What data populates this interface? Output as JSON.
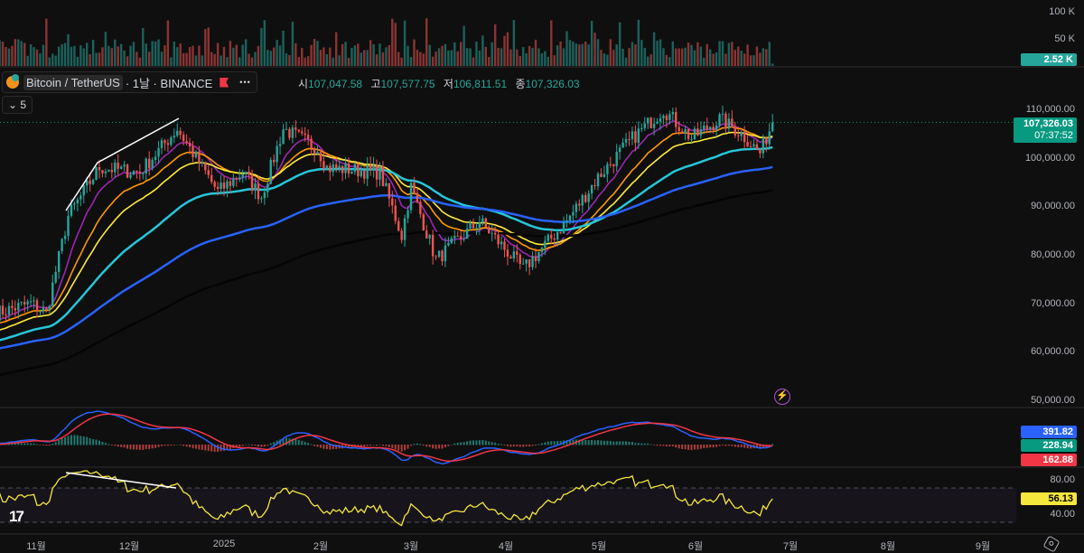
{
  "legend": {
    "symbol": "Bitcoin / TetherUS",
    "interval": "· 1날 · BINANCE",
    "more": "•••",
    "ohlc": [
      {
        "k": "시",
        "v": "107,047.58"
      },
      {
        "k": "고",
        "v": "107,577.75"
      },
      {
        "k": "저",
        "v": "106,811.51"
      },
      {
        "k": "종",
        "v": "107,326.03"
      }
    ],
    "collapse": "5"
  },
  "price_axis": [
    "110,000.00",
    "100,000.00",
    "90,000.00",
    "80,000.00",
    "70,000.00",
    "60,000.00",
    "50,000.00"
  ],
  "volume_axis": [
    "100 K",
    "50 K"
  ],
  "volume_tag": "2.52 K",
  "last_price": {
    "price": "107,326.03",
    "countdown": "07:37:52"
  },
  "macd_tags": {
    "macd": "391.82",
    "histogram": "228.94",
    "signal": "162.88"
  },
  "rsi_axis": [
    "80.00",
    "40.00"
  ],
  "rsi_tag": "56.13",
  "time_axis": [
    "11월",
    "12월",
    "2025",
    "2월",
    "3월",
    "4월",
    "5월",
    "6월",
    "7월",
    "8월",
    "9월"
  ],
  "colors": {
    "up": "#26a69a",
    "down": "#ef5350",
    "accent": "#089981",
    "macd": "#2962ff",
    "signal": "#f23645",
    "rsi": "#f5e83c"
  },
  "icons": {
    "logo": "tradingview-logo",
    "alert": "lightning-icon",
    "settings": "gear-icon",
    "flag": "flag-icon"
  },
  "chart_data": {
    "type": "candlestick",
    "symbol": "BTCUSDT",
    "timeframe": "1D",
    "ylim": [
      50000,
      112000
    ],
    "price_path": [
      [
        "2024-10-20",
        68000
      ],
      [
        "2024-10-31",
        70000
      ],
      [
        "2024-11-05",
        68000
      ],
      [
        "2024-11-12",
        88000
      ],
      [
        "2024-11-22",
        98000
      ],
      [
        "2024-12-05",
        97000
      ],
      [
        "2024-12-17",
        106000
      ],
      [
        "2024-12-30",
        93000
      ],
      [
        "2025-01-07",
        97000
      ],
      [
        "2025-01-13",
        92000
      ],
      [
        "2025-01-20",
        106000
      ],
      [
        "2025-01-31",
        102000
      ],
      [
        "2025-02-03",
        98000
      ],
      [
        "2025-02-20",
        97000
      ],
      [
        "2025-02-27",
        84000
      ],
      [
        "2025-03-02",
        94000
      ],
      [
        "2025-03-10",
        79000
      ],
      [
        "2025-03-24",
        87000
      ],
      [
        "2025-04-07",
        77000
      ],
      [
        "2025-04-21",
        87000
      ],
      [
        "2025-05-01",
        96000
      ],
      [
        "2025-05-12",
        104000
      ],
      [
        "2025-05-22",
        110000
      ],
      [
        "2025-05-31",
        104000
      ],
      [
        "2025-06-09",
        108000
      ],
      [
        "2025-06-16",
        105000
      ],
      [
        "2025-06-22",
        101000
      ],
      [
        "2025-06-26",
        107326
      ]
    ],
    "moving_averages": [
      {
        "period": 10,
        "color": "#9c27b0"
      },
      {
        "period": 20,
        "color": "#ff9800"
      },
      {
        "period": 30,
        "color": "#ffeb3b"
      },
      {
        "period": 60,
        "color": "#26c6da"
      },
      {
        "period": 120,
        "color": "#2962ff"
      },
      {
        "period": 200,
        "color": "#000000"
      }
    ],
    "indicators": [
      "Volume",
      "MACD",
      "RSI"
    ],
    "rsi_levels": [
      70,
      30
    ]
  }
}
